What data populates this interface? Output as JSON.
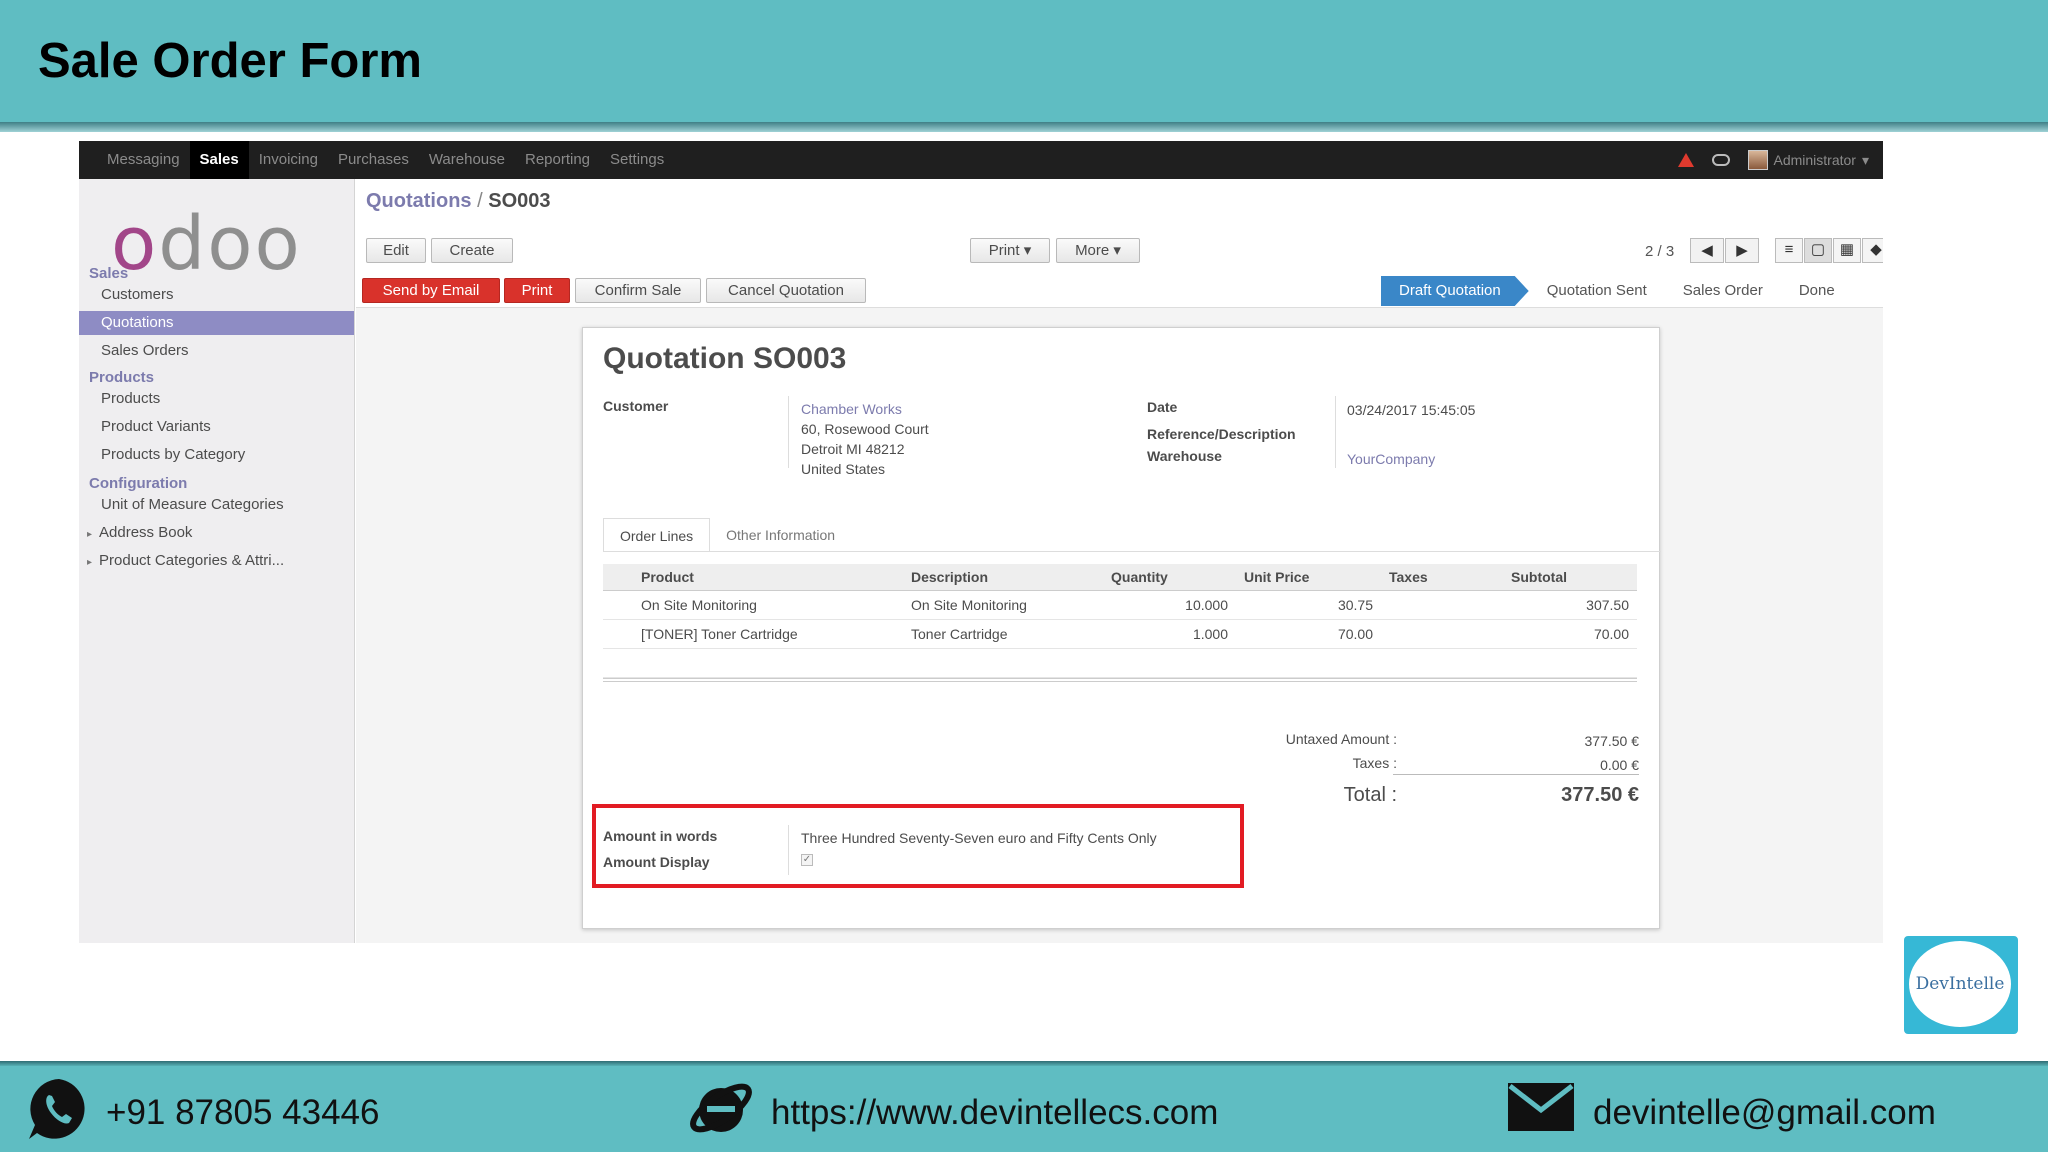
{
  "slide": {
    "title": "Sale Order Form",
    "phone": "+91 87805 43446",
    "website": "https://www.devintellecs.com",
    "email": "devintelle@gmail.com",
    "logo_text": "DevIntelle",
    "bg_color": "#5fbdc2"
  },
  "odoo": {
    "topnav": [
      "Messaging",
      "Sales",
      "Invoicing",
      "Purchases",
      "Warehouse",
      "Reporting",
      "Settings"
    ],
    "active_menu": "Sales",
    "user": "Administrator",
    "logo": "odoo",
    "sidebar": {
      "sales_section": "Sales",
      "sales_items": [
        "Customers",
        "Quotations",
        "Sales Orders"
      ],
      "products_section": "Products",
      "products_items": [
        "Products",
        "Product Variants",
        "Products by Category"
      ],
      "config_section": "Configuration",
      "config_items": [
        "Unit of Measure Categories",
        "Address Book",
        "Product Categories & Attri..."
      ]
    },
    "breadcrumb": {
      "parent": "Quotations",
      "separator": "/",
      "current": "SO003"
    },
    "buttons": {
      "edit": "Edit",
      "create": "Create",
      "print_menu": "Print ▾",
      "more_menu": "More ▾",
      "send_email": "Send by Email",
      "print": "Print",
      "confirm": "Confirm Sale",
      "cancel": "Cancel Quotation"
    },
    "pager": "2 / 3",
    "stages": [
      "Draft Quotation",
      "Quotation Sent",
      "Sales Order",
      "Done"
    ],
    "active_stage": "Draft Quotation",
    "form": {
      "title": "Quotation SO003",
      "customer_label": "Customer",
      "customer_name": "Chamber Works",
      "address1": "60, Rosewood Court",
      "address2": "Detroit MI 48212",
      "address3": "United States",
      "date_label": "Date",
      "date_value": "03/24/2017 15:45:05",
      "ref_label": "Reference/Description",
      "warehouse_label": "Warehouse",
      "warehouse_value": "YourCompany",
      "tabs": [
        "Order Lines",
        "Other Information"
      ],
      "columns": [
        "Product",
        "Description",
        "Quantity",
        "Unit Price",
        "Taxes",
        "Subtotal"
      ],
      "lines": [
        [
          "On Site Monitoring",
          "On Site Monitoring",
          "10.000",
          "30.75",
          "",
          "307.50"
        ],
        [
          "[TONER] Toner Cartridge",
          "Toner Cartridge",
          "1.000",
          "70.00",
          "",
          "70.00"
        ]
      ],
      "untaxed_label": "Untaxed Amount :",
      "untaxed_value": "377.50 €",
      "taxes_label": "Taxes :",
      "taxes_value": "0.00 €",
      "total_label": "Total :",
      "total_value": "377.50 €",
      "amount_words_label": "Amount in words",
      "amount_words_value": "Three Hundred Seventy-Seven euro and Fifty Cents Only",
      "amount_display_label": "Amount Display",
      "amount_display_checked": true
    },
    "highlight_color": "#e21b23"
  }
}
